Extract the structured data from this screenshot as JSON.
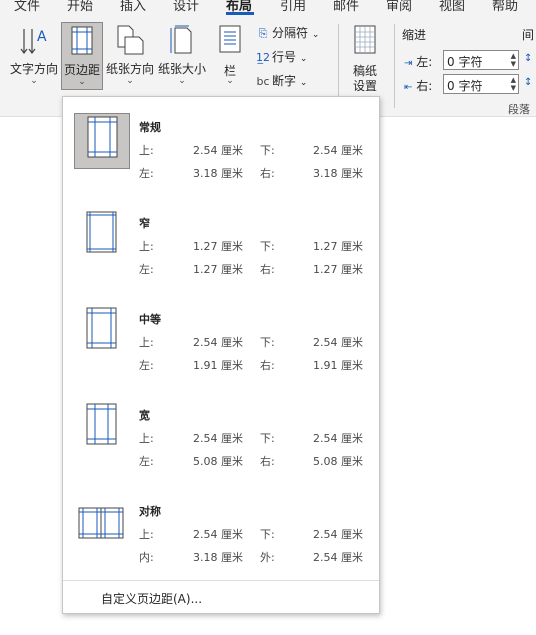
{
  "tabs": [
    "文件",
    "开始",
    "插入",
    "设计",
    "布局",
    "引用",
    "邮件",
    "审阅",
    "视图",
    "帮助"
  ],
  "active_tab": "布局",
  "ribbon": {
    "text_direction": "文字方向",
    "margins": "页边距",
    "orientation": "纸张方向",
    "size": "纸张大小",
    "columns": "栏",
    "breaks": "分隔符",
    "line_numbers": "行号",
    "hyphenation": "断字",
    "manuscript_setup_line1": "稿纸",
    "manuscript_setup_line2": "设置",
    "indent_title": "缩进",
    "spacing_title_partial": "间",
    "indent_left_label": "左:",
    "indent_left_value": "0 字符",
    "indent_right_label": "右:",
    "indent_right_value": "0 字符",
    "paragraph_group_label": "段落"
  },
  "margin_presets": [
    {
      "name": "常规",
      "r1": [
        "上:",
        "2.54 厘米",
        "下:",
        "2.54 厘米"
      ],
      "r2": [
        "左:",
        "3.18 厘米",
        "右:",
        "3.18 厘米"
      ],
      "selected": true
    },
    {
      "name": "窄",
      "r1": [
        "上:",
        "1.27 厘米",
        "下:",
        "1.27 厘米"
      ],
      "r2": [
        "左:",
        "1.27 厘米",
        "右:",
        "1.27 厘米"
      ],
      "selected": false
    },
    {
      "name": "中等",
      "r1": [
        "上:",
        "2.54 厘米",
        "下:",
        "2.54 厘米"
      ],
      "r2": [
        "左:",
        "1.91 厘米",
        "右:",
        "1.91 厘米"
      ],
      "selected": false
    },
    {
      "name": "宽",
      "r1": [
        "上:",
        "2.54 厘米",
        "下:",
        "2.54 厘米"
      ],
      "r2": [
        "左:",
        "5.08 厘米",
        "右:",
        "5.08 厘米"
      ],
      "selected": false
    },
    {
      "name": "对称",
      "r1": [
        "上:",
        "2.54 厘米",
        "下:",
        "2.54 厘米"
      ],
      "r2": [
        "内:",
        "3.18 厘米",
        "外:",
        "2.54 厘米"
      ],
      "selected": false
    }
  ],
  "custom_margins": "自定义页边距(A)...",
  "colors": {
    "accent": "#185abd",
    "ribbon_bg": "#f3f3f3",
    "selected_bg": "#c8c6c4"
  }
}
